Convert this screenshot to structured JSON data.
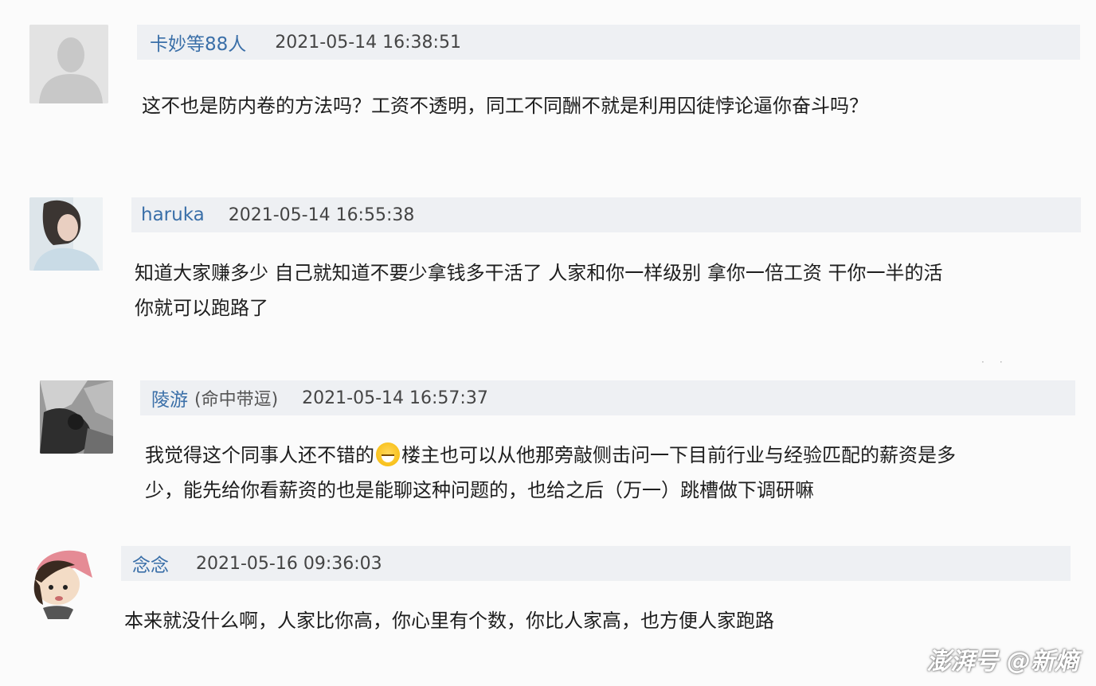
{
  "comments": [
    {
      "username": "卡妙等88人",
      "suffix": "",
      "timestamp": "2021-05-14 16:38:51",
      "lines": [
        "这不也是防内卷的方法吗？工资不透明，同工不同酬不就是利用囚徒悖论逼你奋斗吗？"
      ],
      "avatar": "default-avatar-icon"
    },
    {
      "username": "haruka",
      "suffix": "",
      "timestamp": "2021-05-14 16:55:38",
      "lines": [
        "知道大家赚多少 自己就知道不要少拿钱多干活了 人家和你一样级别 拿你一倍工资 干你一半的活",
        "你就可以跑路了"
      ],
      "avatar": "user-photo"
    },
    {
      "username": "陵游",
      "suffix": "(命中带逗)",
      "timestamp": "2021-05-14 16:57:37",
      "line1_before": "我觉得这个同事人还不错的",
      "line1_after": "楼主也可以从他那旁敲侧击问一下目前行业与经验匹配的薪资是多",
      "line2": "少，能先给你看薪资的也是能聊这种问题的，也给之后（万一）跳槽做下调研嘛",
      "emoji": "laughing-emoji",
      "avatar": "user-photo"
    },
    {
      "username": "念念",
      "suffix": "",
      "timestamp": "2021-05-16 09:36:03",
      "lines": [
        "本来就没什么啊，人家比你高，你心里有个数，你比人家高，也方便人家跑路"
      ],
      "avatar": "cartoon-avatar"
    }
  ],
  "watermark": "澎湃号 @新熵",
  "colors": {
    "username": "#3a6fa8",
    "header_bg": "#eef0f3",
    "page_bg": "#fbfbfb",
    "text": "#1e1e1e"
  }
}
